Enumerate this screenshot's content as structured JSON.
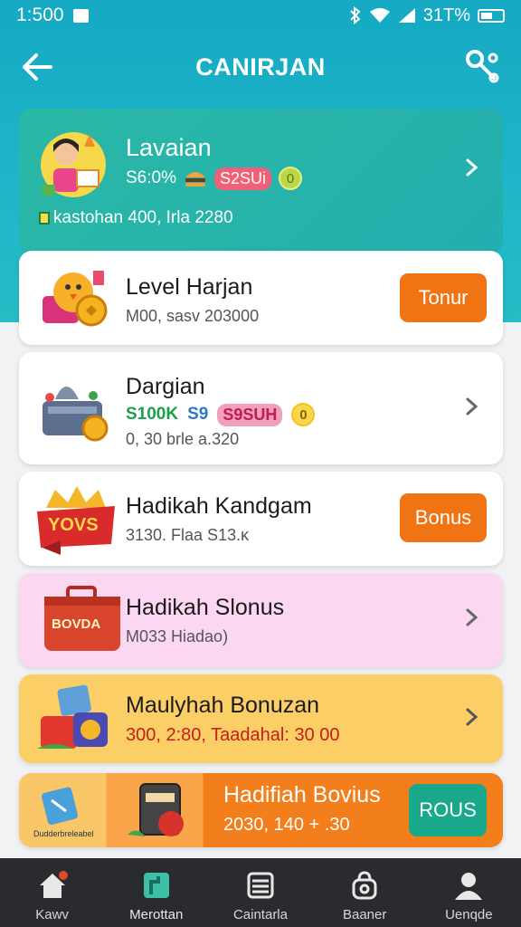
{
  "status_bar": {
    "time": "1:500",
    "battery": "31T%"
  },
  "header": {
    "title": "CANIRJAN"
  },
  "cards": [
    {
      "name": "Lavaian",
      "row_text": "S6:0%",
      "pill": "S2SUi",
      "coin": "0",
      "foot": "kastohan  400, Irla 2280"
    },
    {
      "name": "Level Harjan",
      "sub": "M00, sasv 203000",
      "button": "Tonur"
    },
    {
      "name": "Dargian",
      "row_green": "S100K",
      "row_blue": "S9",
      "pill": "S9SUH",
      "coin": "0",
      "sub": "0, 30 brle a.320"
    },
    {
      "name": "Hadikah Kandgam",
      "sub": "3130. Flaa S13.ĸ",
      "button": "Bonus",
      "badge": "YOVS"
    },
    {
      "name": "Hadikah Slonus",
      "sub": "M033 Hiadao)",
      "badge": "BOVDA"
    },
    {
      "name": "Maulyhah Bonuzan",
      "sub": "300, 2:80, Taadahal: 30 00"
    },
    {
      "name": "Hadifiah Bovius",
      "sub": "2030, 140  + .30",
      "button": "ROUS",
      "mini": "Dudderbreleabel"
    }
  ],
  "tabs": [
    {
      "label": "Kawv"
    },
    {
      "label": "Merottan"
    },
    {
      "label": "Caintarla"
    },
    {
      "label": "Baaner"
    },
    {
      "label": "Uenqde"
    }
  ],
  "colors": {
    "accent": "#1fb6c8",
    "orange": "#f07414",
    "green": "#1aa88a"
  }
}
